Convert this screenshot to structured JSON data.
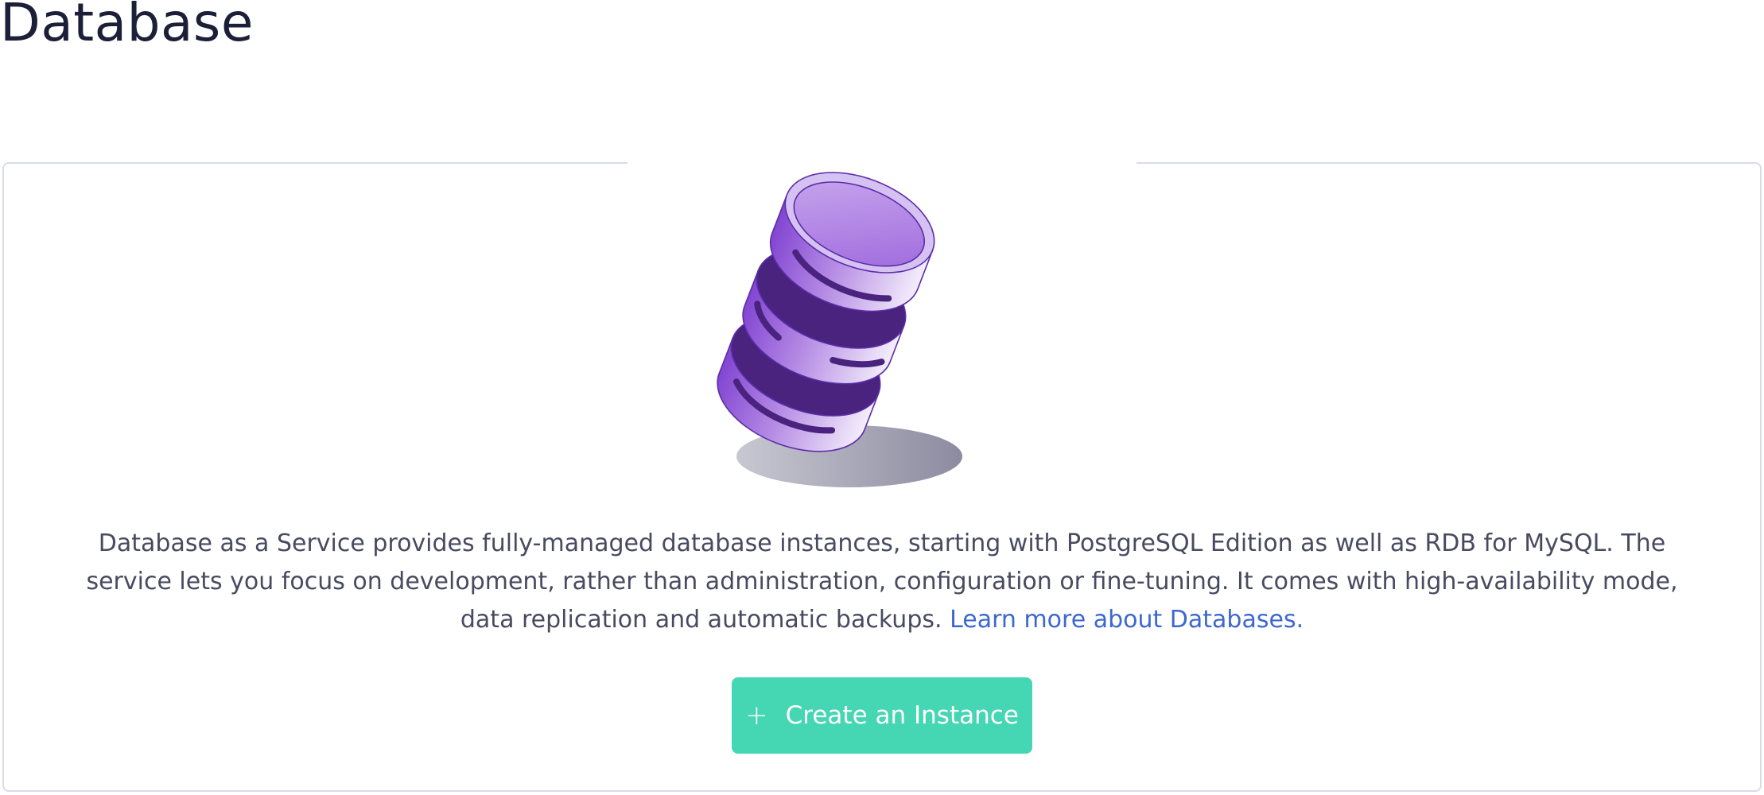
{
  "page": {
    "title": "Database"
  },
  "empty_state": {
    "illustration_icon": "database-stack-icon",
    "description": "Database as a Service provides fully-managed database instances, starting with PostgreSQL Edition as well as RDB for MySQL. The service lets you focus on development, rather than administration, configuration or fine-tuning. It comes with high-availability mode, data replication and automatic backups.",
    "learn_more_link": "Learn more about Databases.",
    "create_button_icon": "plus-icon",
    "create_button_label": "Create an Instance"
  },
  "colors": {
    "title_text": "#1b1f38",
    "body_text": "#484b60",
    "link": "#3d68d0",
    "primary_button": "#45d6b3",
    "illustration_purple": "#8a50d6",
    "card_border": "#d8dcea"
  }
}
